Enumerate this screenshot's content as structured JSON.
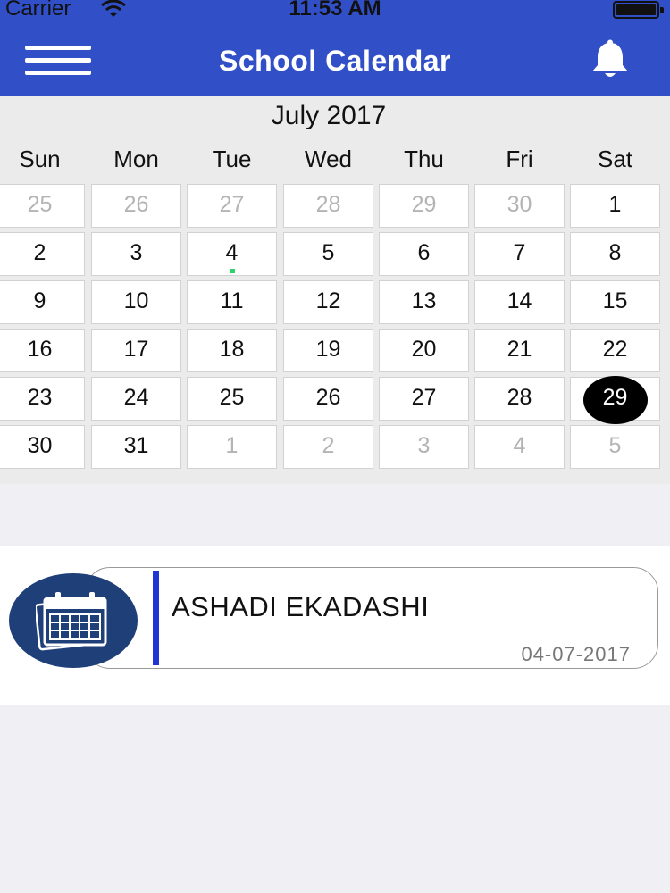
{
  "status_bar": {
    "carrier": "Carrier",
    "time": "11:53 AM"
  },
  "header": {
    "title": "School Calendar",
    "menu_icon": "hamburger-menu-icon",
    "bell_icon": "bell-icon"
  },
  "calendar": {
    "month_label": "July 2017",
    "weekdays": [
      "Sun",
      "Mon",
      "Tue",
      "Wed",
      "Thu",
      "Fri",
      "Sat"
    ],
    "weeks": [
      [
        "25",
        "26",
        "27",
        "28",
        "29",
        "30",
        "1"
      ],
      [
        "2",
        "3",
        "4",
        "5",
        "6",
        "7",
        "8"
      ],
      [
        "9",
        "10",
        "11",
        "12",
        "13",
        "14",
        "15"
      ],
      [
        "16",
        "17",
        "18",
        "19",
        "20",
        "21",
        "22"
      ],
      [
        "23",
        "24",
        "25",
        "26",
        "27",
        "28",
        "29"
      ],
      [
        "30",
        "31",
        "1",
        "2",
        "3",
        "4",
        "5"
      ]
    ],
    "other_month": [
      [
        true,
        true,
        true,
        true,
        true,
        true,
        false
      ],
      [
        false,
        false,
        false,
        false,
        false,
        false,
        false
      ],
      [
        false,
        false,
        false,
        false,
        false,
        false,
        false
      ],
      [
        false,
        false,
        false,
        false,
        false,
        false,
        false
      ],
      [
        false,
        false,
        false,
        false,
        false,
        false,
        false
      ],
      [
        false,
        false,
        true,
        true,
        true,
        true,
        true
      ]
    ],
    "selected_day": "29",
    "event_day": "4",
    "event_dot_color": "#2fd16a"
  },
  "events": [
    {
      "title": "ASHADI EKADASHI",
      "date": "04-07-2017",
      "icon": "calendar-icon",
      "accent_color": "#1f35d6"
    }
  ],
  "colors": {
    "header": "#3150c8",
    "event_icon_bg": "#1f3f78"
  }
}
